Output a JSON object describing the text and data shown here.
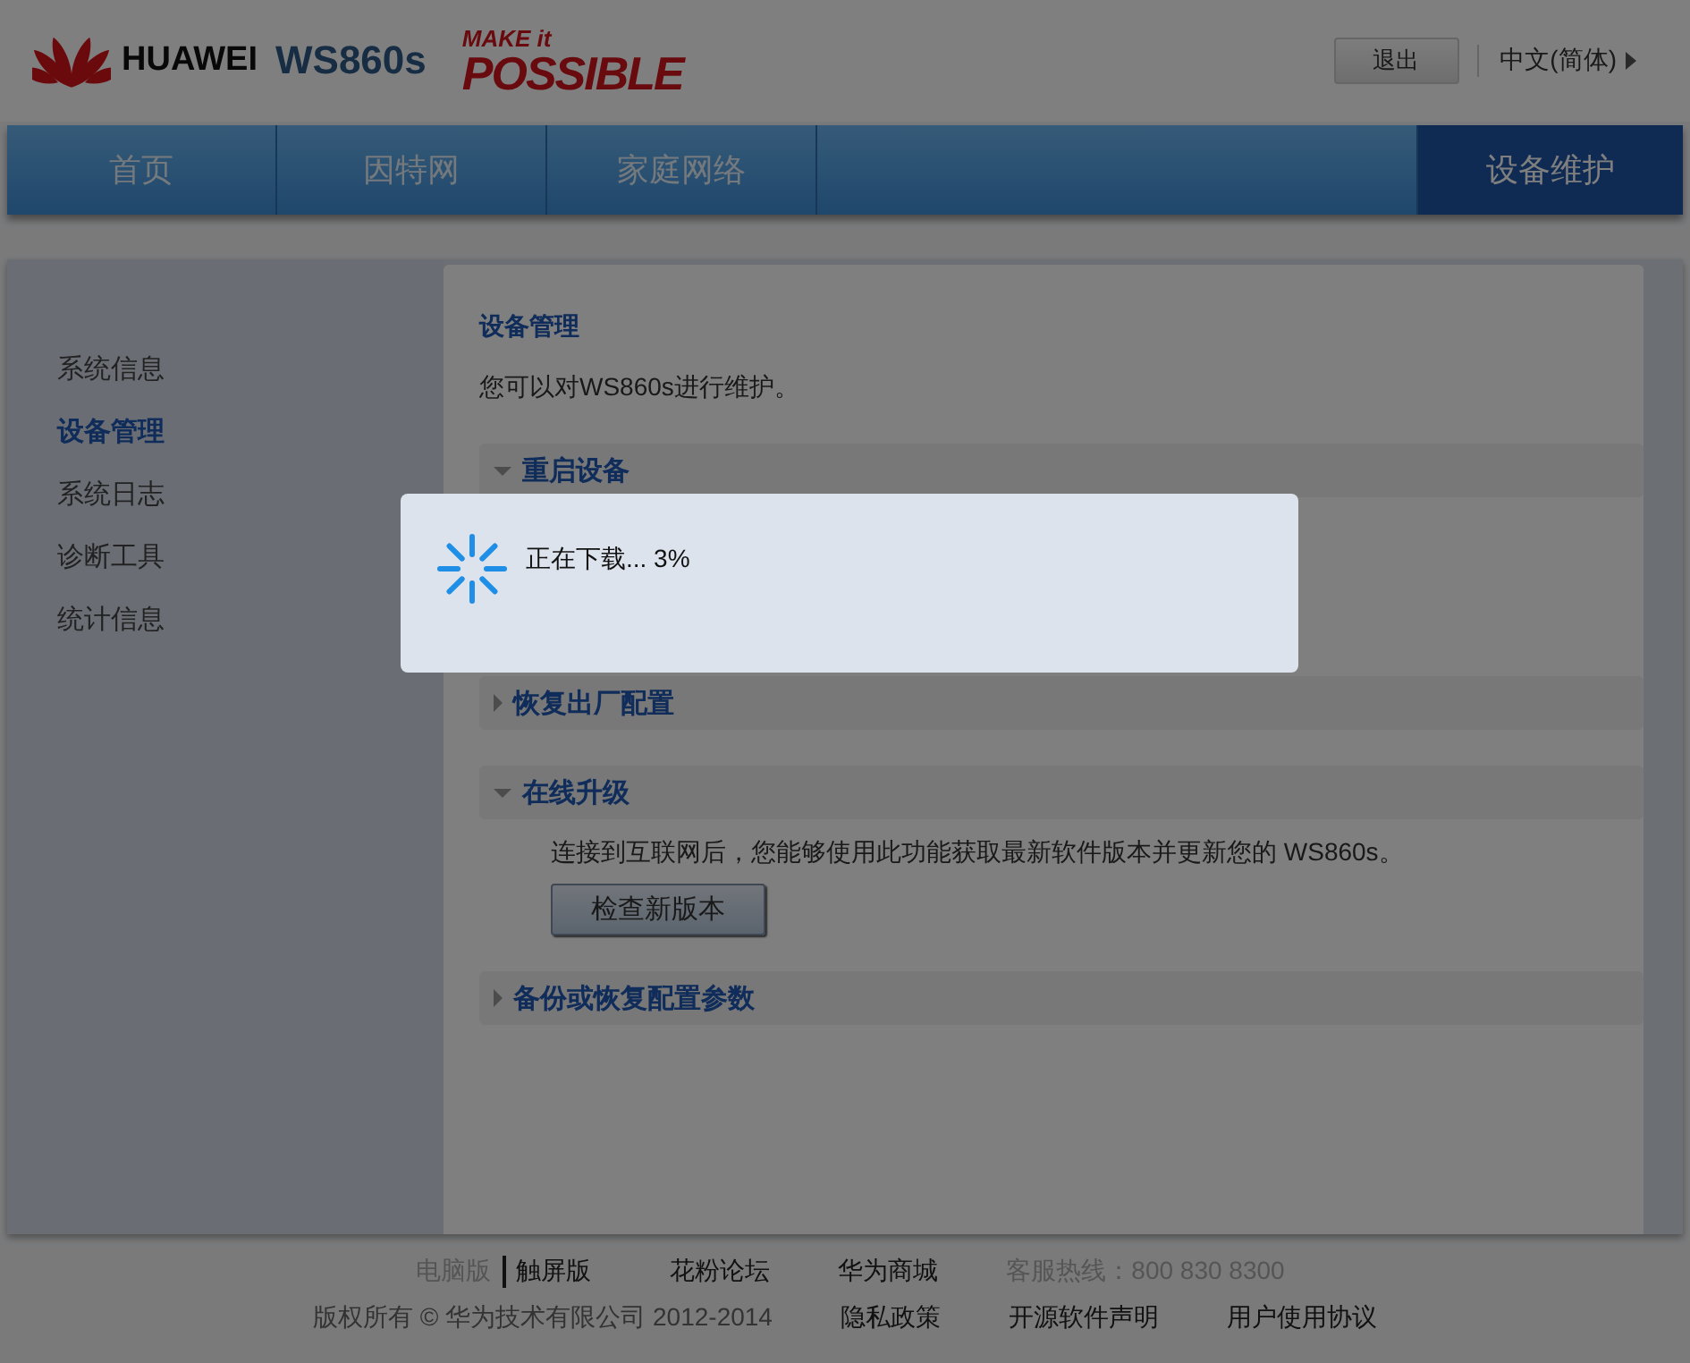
{
  "header": {
    "brand": "HUAWEI",
    "model": "WS860s",
    "slogan_top": "MAKE it",
    "slogan_main": "POSSIBLE",
    "logout_button": "退出",
    "language": "中文(简体)"
  },
  "nav": [
    {
      "label": "首页",
      "selected": false
    },
    {
      "label": "因特网",
      "selected": false
    },
    {
      "label": "家庭网络",
      "selected": false
    },
    {
      "label": "设备维护",
      "selected": true
    }
  ],
  "sidebar": {
    "items": [
      {
        "label": "系统信息",
        "selected": false
      },
      {
        "label": "设备管理",
        "selected": true
      },
      {
        "label": "系统日志",
        "selected": false
      },
      {
        "label": "诊断工具",
        "selected": false
      },
      {
        "label": "统计信息",
        "selected": false
      }
    ]
  },
  "content": {
    "title": "设备管理",
    "intro": "您可以对WS860s进行维护。",
    "sections": [
      {
        "title": "重启设备",
        "expanded": true
      },
      {
        "title": "恢复出厂配置",
        "expanded": false
      },
      {
        "title": "在线升级",
        "expanded": true,
        "text": "连接到互联网后，您能够使用此功能获取最新软件版本并更新您的 WS860s。",
        "button": "检查新版本"
      },
      {
        "title": "备份或恢复配置参数",
        "expanded": false
      }
    ]
  },
  "footer": {
    "versions": [
      {
        "label": "电脑版",
        "selected": true
      },
      {
        "label": "触屏版",
        "selected": false
      }
    ],
    "links": [
      "花粉论坛",
      "华为商城"
    ],
    "hotline": "客服热线：800 830 8300",
    "copyright": "版权所有 © 华为技术有限公司 2012-2014",
    "legal_links": [
      "隐私政策",
      "开源软件声明",
      "用户使用协议"
    ]
  },
  "dialog": {
    "message": "正在下载... 3%"
  }
}
